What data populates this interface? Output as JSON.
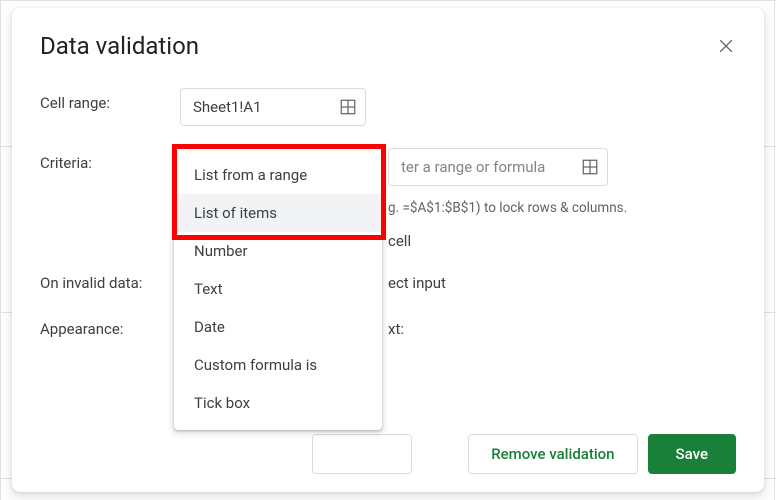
{
  "dialog": {
    "title": "Data validation",
    "cell_range_label": "Cell range:",
    "cell_range_value": "Sheet1!A1",
    "criteria_label": "Criteria:",
    "range_placeholder": "Enter a range or formula",
    "range_visible_fragment": "ter a range or formula",
    "hint_fragment": "g. =$A$1:$B$1) to lock rows & columns.",
    "cell_fragment": "cell",
    "invalid_label": "On invalid data:",
    "invalid_fragment": "ect input",
    "appearance_label": "Appearance:",
    "appearance_fragment": "xt:"
  },
  "dropdown": {
    "items": [
      "List from a range",
      "List of items",
      "Number",
      "Text",
      "Date",
      "Custom formula is",
      "Tick box"
    ],
    "hovered_index": 1
  },
  "footer": {
    "remove": "Remove validation",
    "save": "Save"
  }
}
